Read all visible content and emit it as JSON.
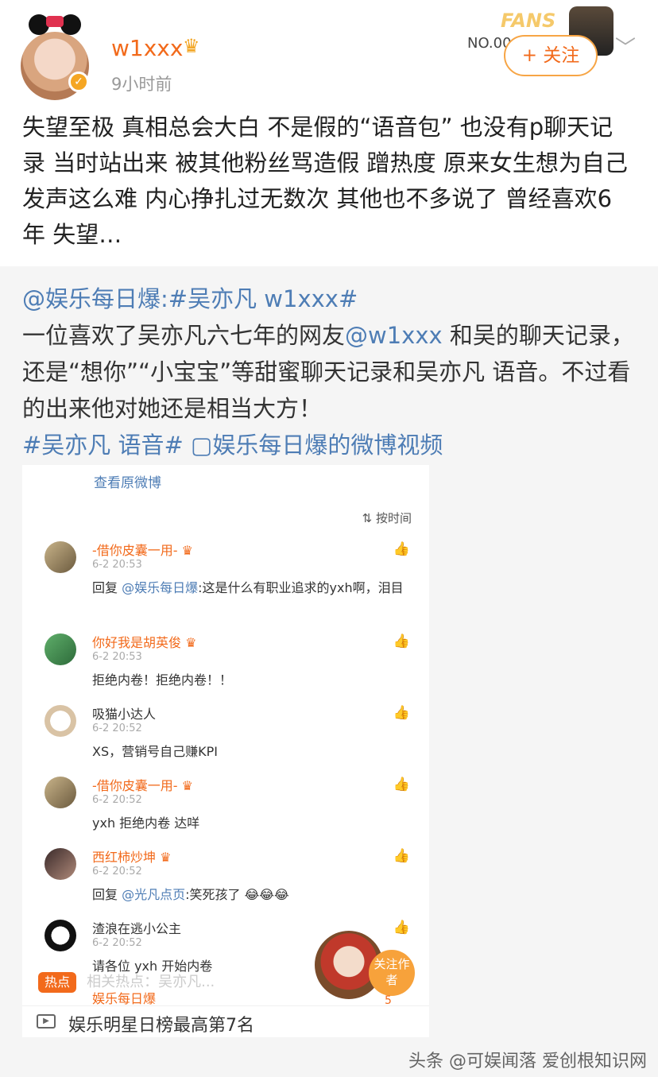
{
  "post": {
    "username": "w1xxx",
    "crown_icon": "crown-icon",
    "time": "9小时前",
    "fans_badge": {
      "word": "FANS",
      "number": "NO.00"
    },
    "follow_label": "+ 关注",
    "text": "失望至极 真相总会大白 不是假的“语音包” 也没有p聊天记录 当时站出来 被其他粉丝骂造假 蹭热度 原来女生想为自己发声这么难 内心挣扎过无数次 其他也不多说了 曾经喜欢6年 失望…"
  },
  "repost": {
    "line1_link": "@娱乐每日爆:#吴亦凡 w1xxx#",
    "body_before": "一位喜欢了吴亦凡六七年的网友",
    "body_mention": "@w1xxx",
    "body_after": " 和吴的聊天记录，还是“想你”“小宝宝”等甜蜜聊天记录和吴亦凡 语音。不过看的出来他对她还是相当大方！",
    "tags_link": "#吴亦凡 语音# ▢娱乐每日爆的微博视频"
  },
  "video": {
    "origin_label": "查看原微博",
    "sort_label": "⇅ 按时间",
    "comments": [
      {
        "name": "-借你皮囊一用-",
        "time": "6-2 20:53",
        "reply_prefix": "回复",
        "reply_to": "@娱乐每日爆",
        "body": ":这是什么有职业追求的yxh啊，泪目"
      },
      {
        "name": "你好我是胡英俊",
        "time": "6-2 20:53",
        "reply_prefix": "",
        "reply_to": "",
        "body": "拒绝内卷！拒绝内卷！！"
      },
      {
        "name": "吸猫小达人",
        "time": "6-2 20:52",
        "reply_prefix": "",
        "reply_to": "",
        "body": "XS，营销号自己赚KPI"
      },
      {
        "name": "-借你皮囊一用-",
        "time": "6-2 20:52",
        "reply_prefix": "",
        "reply_to": "",
        "body": "yxh 拒绝内卷 达咩"
      },
      {
        "name": "西红柿炒坤",
        "time": "6-2 20:52",
        "reply_prefix": "回复",
        "reply_to": "@光凡点页",
        "body": ":笑死孩了 😂😂😂"
      },
      {
        "name": "渣浪在逃小公主",
        "time": "6-2 20:52",
        "reply_prefix": "",
        "reply_to": "",
        "body": "请各位 yxh 开始内卷"
      }
    ],
    "hot_tag": "热点",
    "hot_text": "相关热点：吴亦凡...",
    "next_name": "娱乐每日爆",
    "follow_author": "关注作者",
    "like_count": "5",
    "rank_icon": "video-play-icon",
    "rank_text": "娱乐明星日榜最高第7名"
  },
  "watermark": "头条 @可娱闻落 爱创根知识网"
}
